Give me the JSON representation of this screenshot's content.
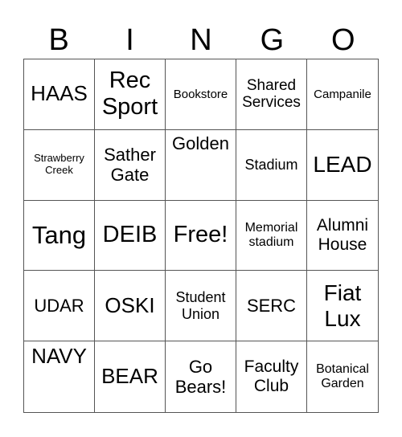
{
  "header": {
    "letters": [
      "B",
      "I",
      "N",
      "G",
      "O"
    ]
  },
  "cells": [
    "HAAS",
    "Rec Sport",
    "Bookstore",
    "Shared Services",
    "Campanile",
    "Strawberry Creek",
    "Sather Gate",
    "Golden",
    "Stadium",
    "LEAD",
    "Tang",
    "DEIB",
    "Free!",
    "Memorial stadium",
    "Alumni House",
    "UDAR",
    "OSKI",
    "Student Union",
    "SERC",
    "Fiat Lux",
    "NAVY",
    "BEAR",
    "Go Bears!",
    "Faculty Club",
    "Botanical Garden"
  ]
}
